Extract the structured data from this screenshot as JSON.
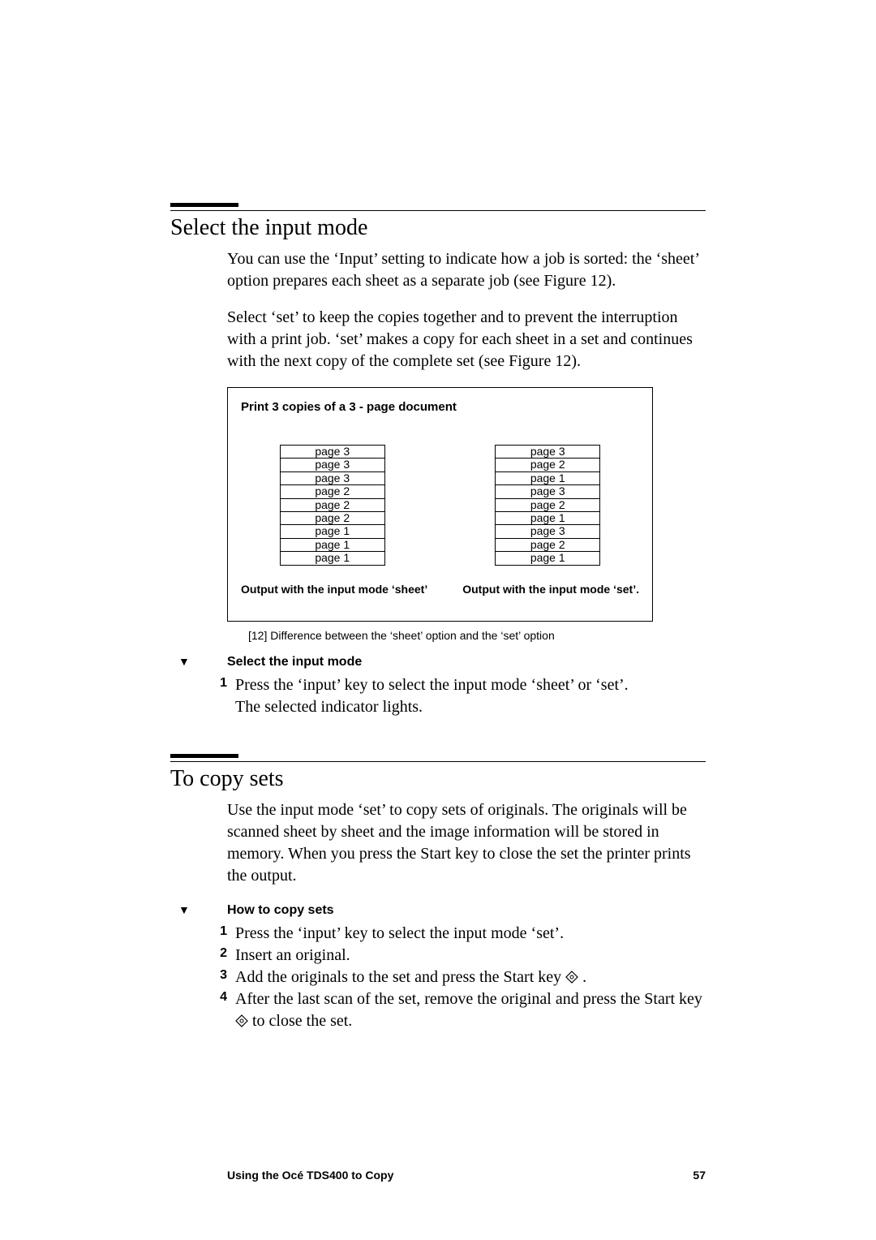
{
  "section1": {
    "heading": "Select the input mode",
    "para1": "You can use the ‘Input’ setting to indicate how a job is sorted: the ‘sheet’ option prepares each sheet as a separate job (see Figure 12).",
    "para2": "Select ‘set’ to keep the copies together and to prevent the interruption with a print job. ‘set’ makes a copy for each sheet in a set and continues with the next copy of the complete set (see Figure 12)."
  },
  "figure": {
    "title": "Print 3 copies of a 3 - page document",
    "sheet_column": [
      "page 3",
      "page 3",
      "page 3",
      "page 2",
      "page 2",
      "page 2",
      "page 1",
      "page 1",
      "page 1"
    ],
    "set_column": [
      "page 3",
      "page 2",
      "page 1",
      "page 3",
      "page 2",
      "page 1",
      "page 3",
      "page 2",
      "page 1"
    ],
    "caption_left": "Output with the input mode ‘sheet’",
    "caption_right": "Output with the input mode ‘set’.",
    "caption": "[12] Difference between the ‘sheet’ option and the ‘set’ option"
  },
  "procedure1": {
    "heading": "Select the input mode",
    "step1_a": "Press the ‘input’ key to select the input mode ‘sheet’ or ‘set’.",
    "step1_b": "The selected indicator lights."
  },
  "section2": {
    "heading": "To copy sets",
    "para1": "Use the input mode ‘set’ to copy sets of originals. The originals will be scanned sheet by sheet and the image information will be stored in memory. When you press the Start key to close the set the printer prints the output."
  },
  "procedure2": {
    "heading": "How to copy sets",
    "step1": "Press the ‘input’ key to select the input mode ‘set’.",
    "step2": "Insert an original.",
    "step3_a": "Add the originals to the set and press the Start key ",
    "step3_b": " .",
    "step4_a": "After the last scan of the set, remove the original and press the Start key ",
    "step4_b": " to close the set."
  },
  "footer": {
    "chapter": "Using the Océ TDS400 to Copy",
    "page_number": "57"
  },
  "step_numbers": {
    "n1": "1",
    "n2": "2",
    "n3": "3",
    "n4": "4"
  }
}
